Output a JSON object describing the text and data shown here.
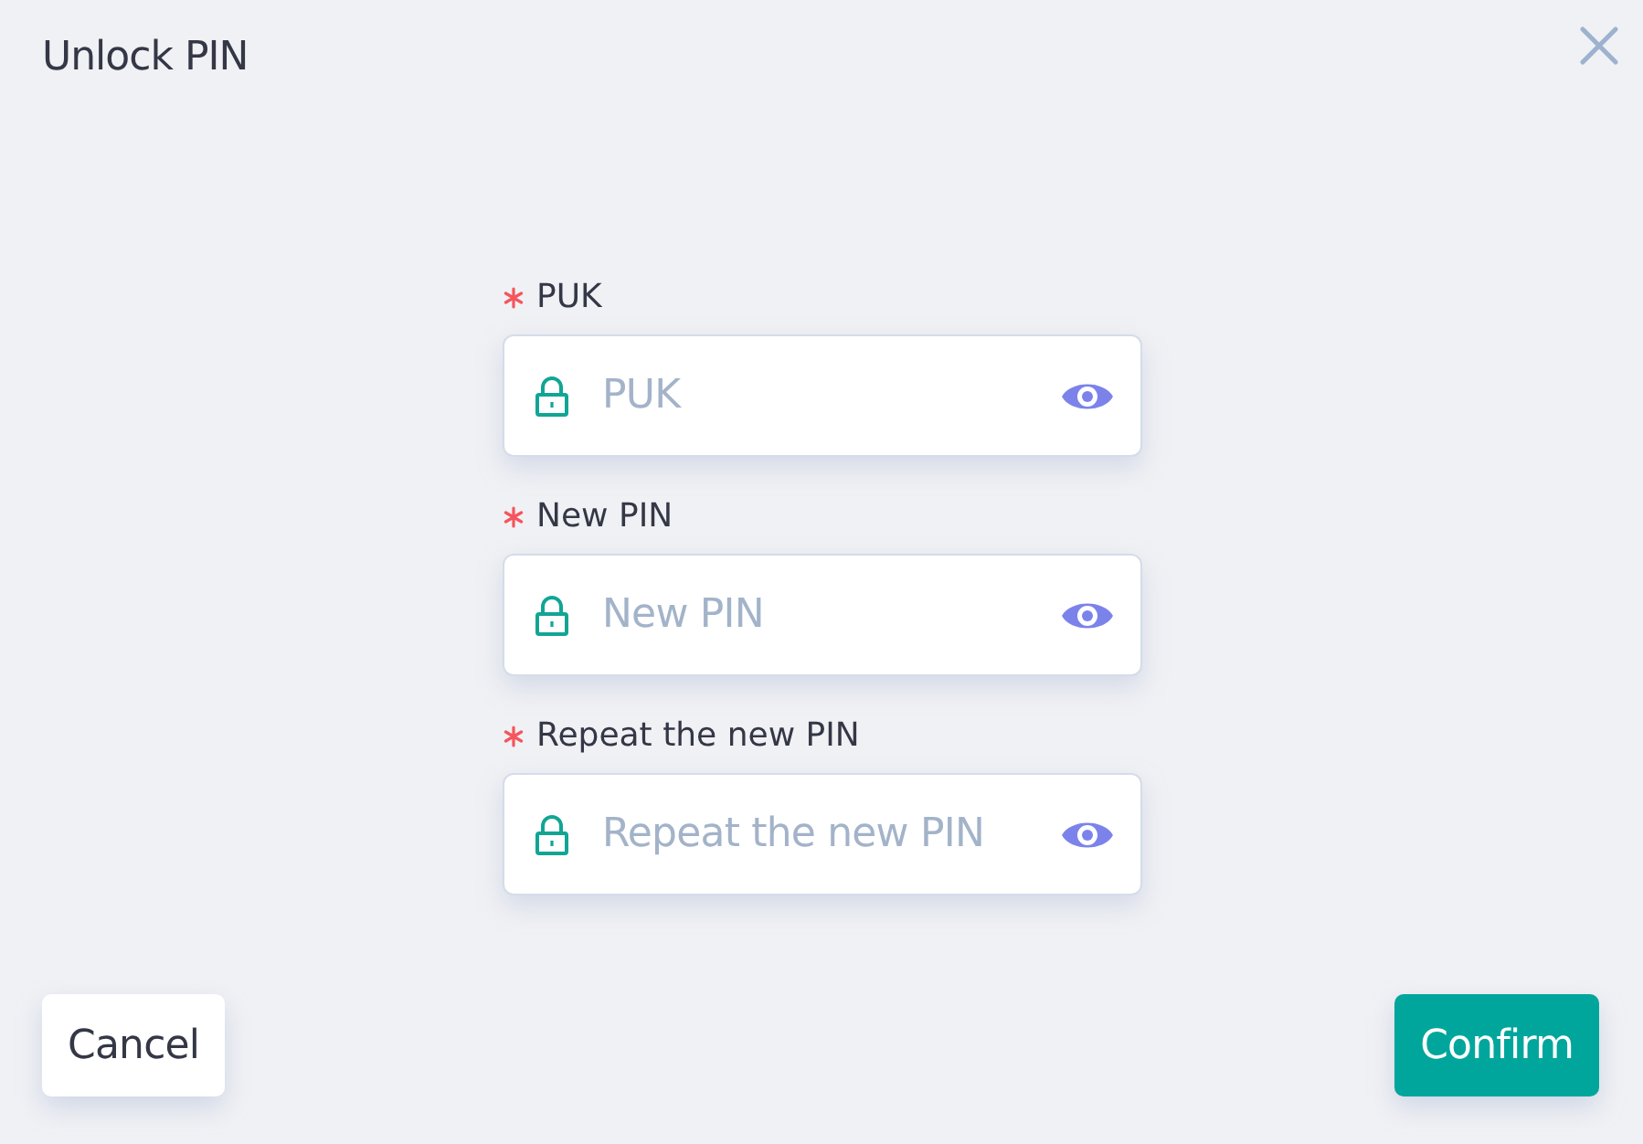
{
  "dialog": {
    "title": "Unlock PIN"
  },
  "fields": [
    {
      "label": "PUK",
      "required": true,
      "placeholder": "PUK"
    },
    {
      "label": "New PIN",
      "required": true,
      "placeholder": "New PIN"
    },
    {
      "label": "Repeat the new PIN",
      "required": true,
      "placeholder": "Repeat the new PIN"
    }
  ],
  "buttons": [
    {
      "label": "Cancel",
      "kind": "secondary"
    },
    {
      "label": "Confirm",
      "kind": "primary"
    }
  ]
}
